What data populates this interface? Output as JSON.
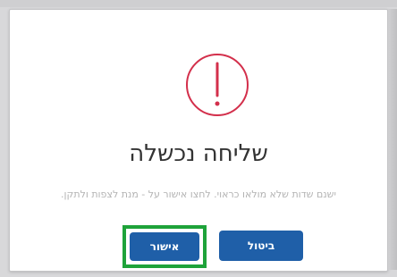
{
  "dialog": {
    "title": "שליחה נכשלה",
    "message": "ישנם שדות שלא מולאו כראוי. לחצו אישור על - מנת לצפות ולתקן.",
    "buttons": {
      "confirm": "אישור",
      "cancel": "ביטול"
    },
    "icon": "alert-circle-icon",
    "colors": {
      "icon_red": "#d32f4b",
      "button_blue": "#1f5fa8",
      "highlight_green": "#1ea33a"
    }
  }
}
